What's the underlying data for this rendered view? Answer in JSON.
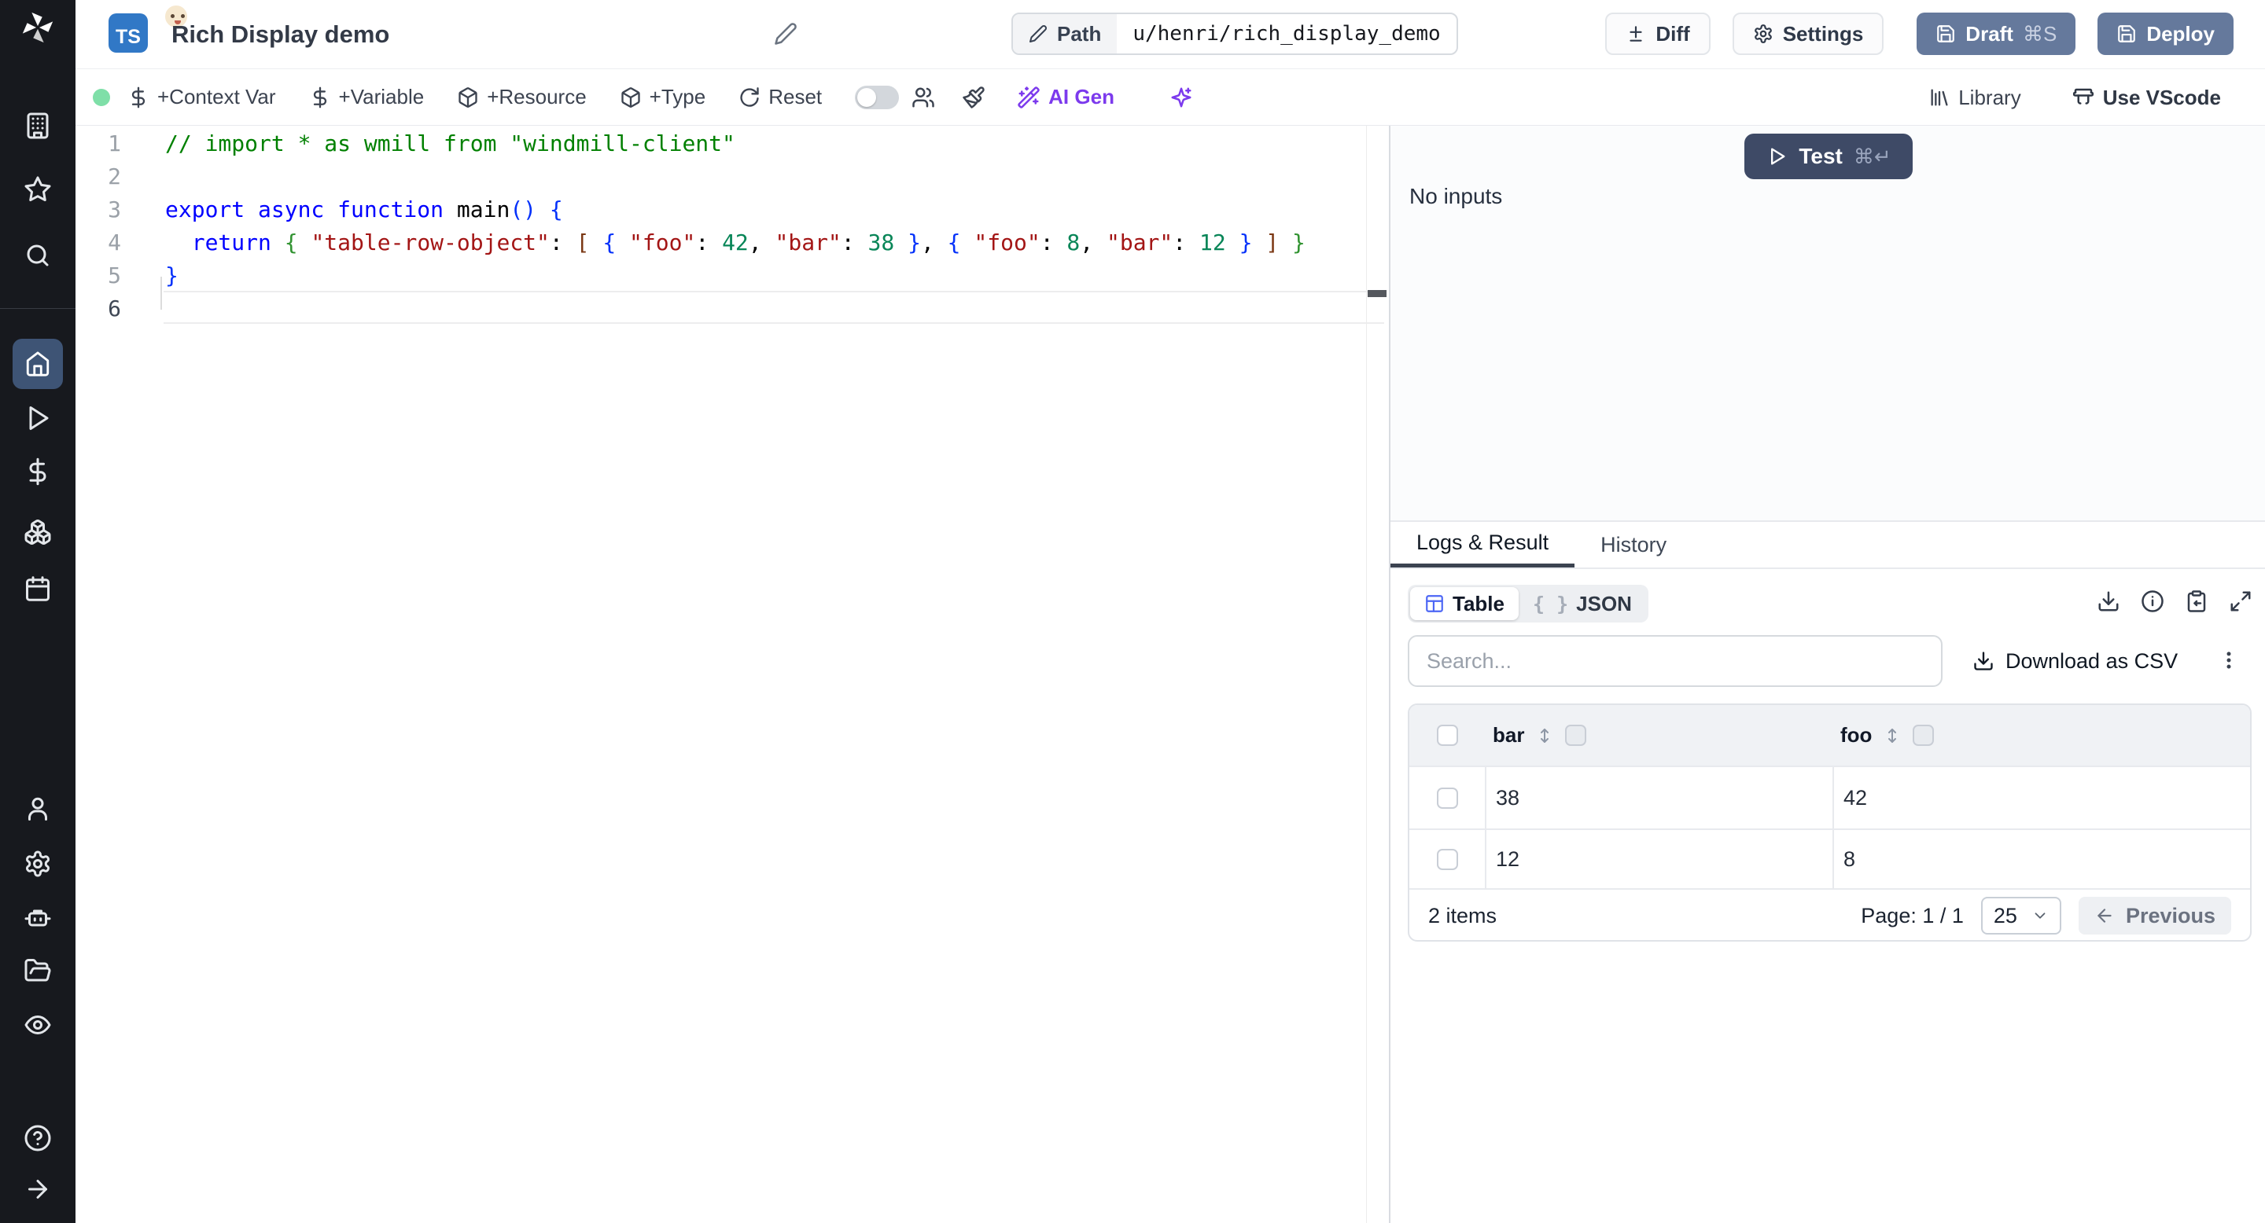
{
  "colors": {
    "sidebar_bg": "#17191e",
    "active_nav": "#3e5475",
    "primary_button": "#65799c",
    "test_button": "#3e4a66",
    "ai_accent": "#7c3aed",
    "table_icon_blue": "#4c66f5",
    "status_green": "#7fdfa8",
    "ts_badge_blue": "#3178c6"
  },
  "sidebar": {
    "icons": [
      "windmill-logo",
      "building",
      "star",
      "search",
      "home",
      "play",
      "dollar",
      "boxes",
      "calendar",
      "user",
      "settings",
      "bot",
      "folder-open",
      "eye",
      "help",
      "arrow-right"
    ]
  },
  "header": {
    "lang_badge": "TS",
    "title": "Rich Display demo",
    "path_label": "Path",
    "path_value": "u/henri/rich_display_demo",
    "diff_label": "Diff",
    "settings_label": "Settings",
    "draft_label": "Draft",
    "draft_shortcut": "⌘S",
    "deploy_label": "Deploy"
  },
  "toolbar": {
    "context_var": "+Context Var",
    "variable": "+Variable",
    "resource": "+Resource",
    "type": "+Type",
    "reset": "Reset",
    "ai_gen": "AI Gen",
    "library": "Library",
    "use_vscode": "Use VScode"
  },
  "editor": {
    "line_numbers": [
      "1",
      "2",
      "3",
      "4",
      "5",
      "6"
    ],
    "code": {
      "l1": [
        {
          "t": "// import * as wmill from \"windmill-client\""
        }
      ],
      "l3": [
        {
          "t": "export async function "
        },
        {
          "t": "main"
        },
        {
          "t": "()"
        },
        {
          "t": " "
        },
        {
          "t": "{"
        }
      ],
      "l4": [
        {
          "t": "  "
        },
        {
          "t": "return"
        },
        {
          "t": " "
        },
        {
          "t": "{"
        },
        {
          "t": " "
        },
        {
          "t": "\"table-row-object\""
        },
        {
          "t": ": "
        },
        {
          "t": "["
        },
        {
          "t": " "
        },
        {
          "t": "{"
        },
        {
          "t": " "
        },
        {
          "t": "\"foo\""
        },
        {
          "t": ": "
        },
        {
          "t": "42"
        },
        {
          "t": ", "
        },
        {
          "t": "\"bar\""
        },
        {
          "t": ": "
        },
        {
          "t": "38"
        },
        {
          "t": " "
        },
        {
          "t": "}"
        },
        {
          "t": ", "
        },
        {
          "t": "{"
        },
        {
          "t": " "
        },
        {
          "t": "\"foo\""
        },
        {
          "t": ": "
        },
        {
          "t": "8"
        },
        {
          "t": ", "
        },
        {
          "t": "\"bar\""
        },
        {
          "t": ": "
        },
        {
          "t": "12"
        },
        {
          "t": " "
        },
        {
          "t": "}"
        },
        {
          "t": " "
        },
        {
          "t": "]"
        },
        {
          "t": " "
        },
        {
          "t": "}"
        }
      ],
      "l5": [
        {
          "t": "}"
        }
      ]
    }
  },
  "run": {
    "test_label": "Test",
    "test_shortcut": "⌘↵",
    "no_inputs": "No inputs"
  },
  "results": {
    "tabs": [
      {
        "label": "Logs & Result"
      },
      {
        "label": "History"
      }
    ],
    "view_table": "Table",
    "view_json": "JSON",
    "json_glyph": "{ }",
    "search_placeholder": "Search...",
    "download_csv": "Download as CSV",
    "table": {
      "columns": [
        "bar",
        "foo"
      ],
      "rows": [
        [
          "38",
          "42"
        ],
        [
          "12",
          "8"
        ]
      ],
      "items_label": "2 items",
      "page_label": "Page: 1 / 1",
      "page_size": "25",
      "previous_label": "Previous"
    }
  }
}
